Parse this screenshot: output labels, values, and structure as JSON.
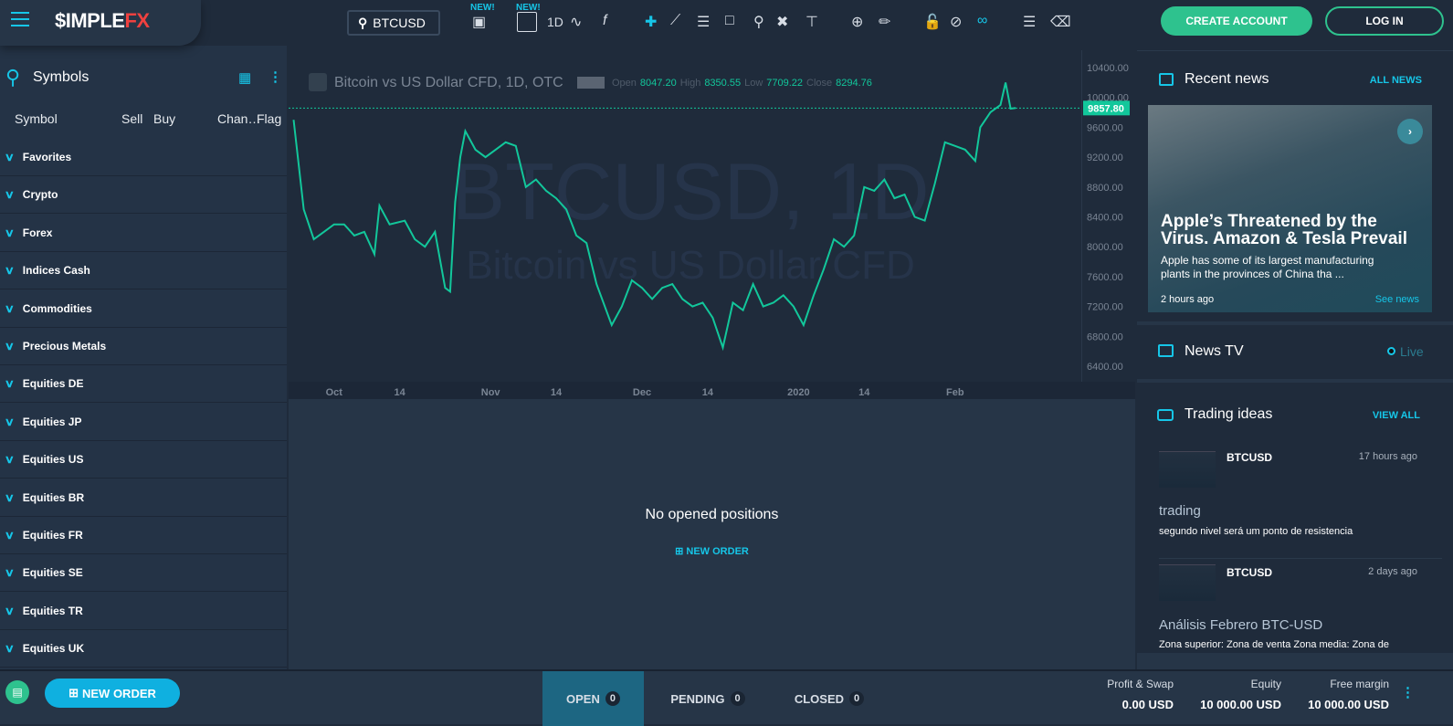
{
  "header": {
    "logo_main": "$IMPLE",
    "logo_accent": "FX",
    "search_value": "BTCUSD",
    "new_badge": "NEW!",
    "interval": "1D",
    "create_account": "CREATE ACCOUNT",
    "login": "LOG IN"
  },
  "sidebar": {
    "title": "Symbols",
    "columns": [
      "Symbol",
      "Sell",
      "Buy",
      "Chan…",
      "Flag"
    ],
    "categories": [
      "Favorites",
      "Crypto",
      "Forex",
      "Indices Cash",
      "Commodities",
      "Precious Metals",
      "Equities DE",
      "Equities JP",
      "Equities US",
      "Equities BR",
      "Equities FR",
      "Equities SE",
      "Equities TR",
      "Equities UK"
    ]
  },
  "legend": {
    "title": "Bitcoin vs US Dollar CFD, 1D, OTC",
    "open_label": "Open",
    "open": "8047.20",
    "high_label": "High",
    "high": "8350.55",
    "low_label": "Low",
    "low": "7709.22",
    "close_label": "Close",
    "close": "8294.76"
  },
  "watermark": {
    "big": "BTCUSD, 1D",
    "sub": "Bitcoin vs US Dollar CFD"
  },
  "positions": {
    "empty": "No opened positions",
    "new_order": "NEW ORDER"
  },
  "news": {
    "title": "Recent news",
    "all": "ALL NEWS",
    "headline": "Apple’s Threatened by the Virus. Amazon & Tesla Prevail",
    "summary": "Apple has some of its largest manufacturing plants in the provinces of China tha ...",
    "time": "2 hours ago",
    "see": "See news"
  },
  "newstv": {
    "title": "News TV",
    "live": "Live"
  },
  "ideas": {
    "title": "Trading ideas",
    "all": "VIEW ALL",
    "items": [
      {
        "symbol": "BTCUSD",
        "time": "17 hours ago",
        "title": "trading",
        "desc": "segundo nivel será um ponto de resistencia"
      },
      {
        "symbol": "BTCUSD",
        "time": "2 days ago",
        "title": "Análisis Febrero BTC-USD",
        "desc": "Zona superior: Zona de venta Zona media: Zona de"
      }
    ]
  },
  "bottom": {
    "new_order": "NEW ORDER",
    "tabs": [
      {
        "label": "OPEN",
        "count": "0"
      },
      {
        "label": "PENDING",
        "count": "0"
      },
      {
        "label": "CLOSED",
        "count": "0"
      }
    ],
    "profit_label": "Profit & Swap",
    "profit": "0.00 USD",
    "equity_label": "Equity",
    "equity": "10 000.00 USD",
    "margin_label": "Free margin",
    "margin": "10 000.00 USD"
  },
  "colors": {
    "accent": "#16c6e8",
    "green": "#12c79b",
    "logo_red": "#f0413f"
  },
  "chart_data": {
    "type": "line",
    "title": "Bitcoin vs US Dollar CFD, 1D, OTC",
    "ylim": [
      6400,
      10400
    ],
    "yticks": [
      "10400.00",
      "10000.00",
      "9600.00",
      "9200.00",
      "8800.00",
      "8400.00",
      "8000.00",
      "7600.00",
      "7200.00",
      "6800.00",
      "6400.00"
    ],
    "xticks": [
      {
        "label": "Oct",
        "date": "2019-10-01"
      },
      {
        "label": "14",
        "date": "2019-10-14"
      },
      {
        "label": "Nov",
        "date": "2019-11-01"
      },
      {
        "label": "14",
        "date": "2019-11-14"
      },
      {
        "label": "Dec",
        "date": "2019-12-01"
      },
      {
        "label": "14",
        "date": "2019-12-14"
      },
      {
        "label": "2020",
        "date": "2020-01-01"
      },
      {
        "label": "14",
        "date": "2020-01-14"
      },
      {
        "label": "Feb",
        "date": "2020-02-01"
      }
    ],
    "xrange": [
      "2019-09-22",
      "2020-02-26"
    ],
    "last_price": "9857.80",
    "points": [
      [
        "2019-09-23",
        9700
      ],
      [
        "2019-09-25",
        8500
      ],
      [
        "2019-09-27",
        8100
      ],
      [
        "2019-09-29",
        8200
      ],
      [
        "2019-10-01",
        8300
      ],
      [
        "2019-10-03",
        8300
      ],
      [
        "2019-10-05",
        8150
      ],
      [
        "2019-10-07",
        8200
      ],
      [
        "2019-10-09",
        7900
      ],
      [
        "2019-10-10",
        8550
      ],
      [
        "2019-10-12",
        8300
      ],
      [
        "2019-10-15",
        8350
      ],
      [
        "2019-10-17",
        8100
      ],
      [
        "2019-10-19",
        8000
      ],
      [
        "2019-10-21",
        8200
      ],
      [
        "2019-10-23",
        7450
      ],
      [
        "2019-10-24",
        7400
      ],
      [
        "2019-10-25",
        8600
      ],
      [
        "2019-10-26",
        9200
      ],
      [
        "2019-10-27",
        9550
      ],
      [
        "2019-10-29",
        9300
      ],
      [
        "2019-10-31",
        9200
      ],
      [
        "2019-11-02",
        9300
      ],
      [
        "2019-11-04",
        9400
      ],
      [
        "2019-11-06",
        9350
      ],
      [
        "2019-11-08",
        8800
      ],
      [
        "2019-11-10",
        8900
      ],
      [
        "2019-11-12",
        8750
      ],
      [
        "2019-11-14",
        8650
      ],
      [
        "2019-11-16",
        8500
      ],
      [
        "2019-11-18",
        8150
      ],
      [
        "2019-11-20",
        8050
      ],
      [
        "2019-11-22",
        7500
      ],
      [
        "2019-11-25",
        6950
      ],
      [
        "2019-11-27",
        7200
      ],
      [
        "2019-11-29",
        7550
      ],
      [
        "2019-12-01",
        7450
      ],
      [
        "2019-12-03",
        7300
      ],
      [
        "2019-12-05",
        7450
      ],
      [
        "2019-12-07",
        7500
      ],
      [
        "2019-12-09",
        7300
      ],
      [
        "2019-12-11",
        7200
      ],
      [
        "2019-12-13",
        7250
      ],
      [
        "2019-12-15",
        7050
      ],
      [
        "2019-12-17",
        6650
      ],
      [
        "2019-12-19",
        7250
      ],
      [
        "2019-12-21",
        7150
      ],
      [
        "2019-12-23",
        7500
      ],
      [
        "2019-12-25",
        7200
      ],
      [
        "2019-12-27",
        7250
      ],
      [
        "2019-12-29",
        7350
      ],
      [
        "2019-12-31",
        7200
      ],
      [
        "2020-01-02",
        6950
      ],
      [
        "2020-01-04",
        7350
      ],
      [
        "2020-01-06",
        7700
      ],
      [
        "2020-01-08",
        8100
      ],
      [
        "2020-01-10",
        8000
      ],
      [
        "2020-01-12",
        8150
      ],
      [
        "2020-01-14",
        8800
      ],
      [
        "2020-01-16",
        8750
      ],
      [
        "2020-01-18",
        8900
      ],
      [
        "2020-01-20",
        8650
      ],
      [
        "2020-01-22",
        8700
      ],
      [
        "2020-01-24",
        8400
      ],
      [
        "2020-01-26",
        8350
      ],
      [
        "2020-01-28",
        8850
      ],
      [
        "2020-01-30",
        9400
      ],
      [
        "2020-02-01",
        9350
      ],
      [
        "2020-02-03",
        9300
      ],
      [
        "2020-02-05",
        9150
      ],
      [
        "2020-02-06",
        9600
      ],
      [
        "2020-02-08",
        9800
      ],
      [
        "2020-02-10",
        9900
      ],
      [
        "2020-02-11",
        10200
      ],
      [
        "2020-02-12",
        9850
      ],
      [
        "2020-02-13",
        9858
      ]
    ]
  }
}
